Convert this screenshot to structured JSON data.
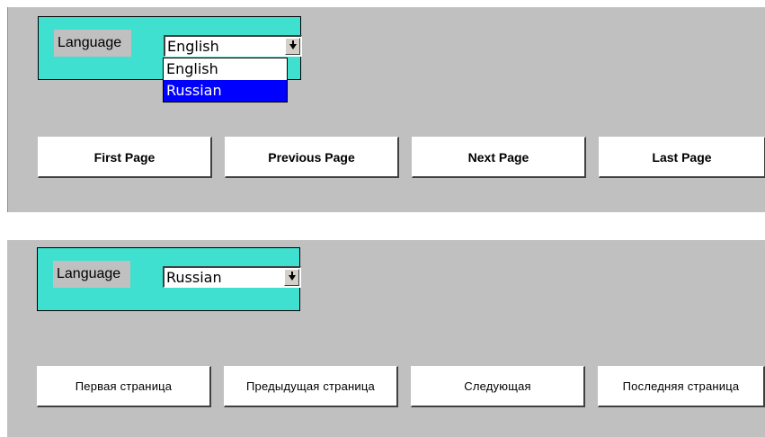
{
  "english_view": {
    "language_label": "Language",
    "language_select": {
      "selected": "English",
      "options": [
        "English",
        "Russian"
      ],
      "highlighted": "Russian"
    },
    "buttons": {
      "first": "First Page",
      "previous": "Previous Page",
      "next": "Next Page",
      "last": "Last Page"
    }
  },
  "russian_view": {
    "language_label": "Language",
    "language_select": {
      "selected": "Russian"
    },
    "buttons": {
      "first": "Первая страница",
      "previous": "Предыдущая страница",
      "next": "Следующая",
      "last": "Последняя страница"
    }
  },
  "colors": {
    "panel_bg": "#c0c0c0",
    "language_box": "#40e0d0",
    "highlight": "#0000ff"
  }
}
